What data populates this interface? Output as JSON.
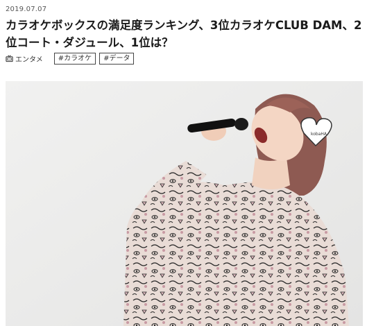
{
  "article": {
    "date": "2019.07.07",
    "title": "カラオケボックスの満足度ランキング、3位カラオケCLUB DAM、2位コート・ダジュール、1位は？",
    "category": {
      "label": "エンタメ",
      "icon": "tv-icon"
    },
    "tags": [
      "#カラオケ",
      "#データ"
    ]
  },
  "hero_image": {
    "description_icon": "photo",
    "badge_text": "kobaHA"
  }
}
